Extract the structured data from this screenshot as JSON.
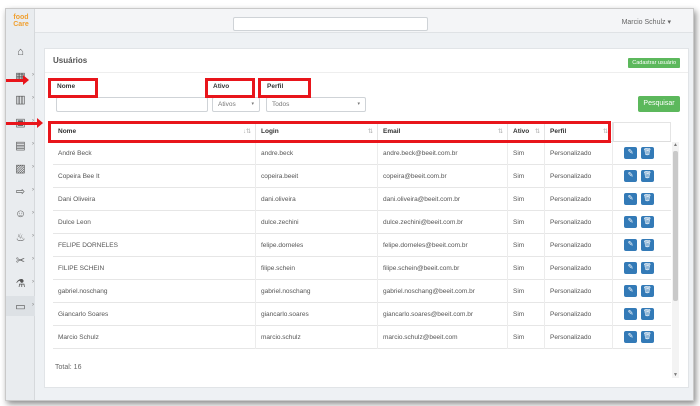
{
  "app": {
    "logo": "food Care"
  },
  "header": {
    "user_name": "Marcio Schulz"
  },
  "page": {
    "title": "Usuários",
    "add_button": "Cadastrar usuário",
    "search_button": "Pesquisar",
    "total": "Total: 16"
  },
  "filters": {
    "name_label": "Nome",
    "name_value": "",
    "active_label": "Ativo",
    "active_value": "Ativos",
    "profile_label": "Perfil",
    "profile_value": "Todos"
  },
  "table": {
    "columns": [
      "Nome",
      "Login",
      "Email",
      "Ativo",
      "Perfil"
    ],
    "rows": [
      [
        "André Beck",
        "andre.beck",
        "andre.beck@beeit.com.br",
        "Sim",
        "Personalizado"
      ],
      [
        "Copeira Bee It",
        "copeira.beeit",
        "copeira@beeit.com.br",
        "Sim",
        "Personalizado"
      ],
      [
        "Dani Oliveira",
        "dani.oliveira",
        "dani.oliveira@beeit.com.br",
        "Sim",
        "Personalizado"
      ],
      [
        "Dulce Leon",
        "dulce.zechini",
        "dulce.zechini@beeit.com.br",
        "Sim",
        "Personalizado"
      ],
      [
        "FELIPE DORNELES",
        "felipe.dorneles",
        "felipe.dorneles@beeit.com.br",
        "Sim",
        "Personalizado"
      ],
      [
        "FILIPE SCHEIN",
        "filipe.schein",
        "filipe.schein@beeit.com.br",
        "Sim",
        "Personalizado"
      ],
      [
        "gabriel.noschang",
        "gabriel.noschang",
        "gabriel.noschang@beeit.com.br",
        "Sim",
        "Personalizado"
      ],
      [
        "Giancarlo Soares",
        "giancarlo.soares",
        "giancarlo.soares@beeit.com.br",
        "Sim",
        "Personalizado"
      ],
      [
        "Marcio Schulz",
        "marcio.schulz",
        "marcio.schulz@beeit.com",
        "Sim",
        "Personalizado"
      ]
    ]
  },
  "sidebar": {
    "items": [
      {
        "icon": "home-icon"
      },
      {
        "icon": "grid-icon"
      },
      {
        "icon": "building-icon"
      },
      {
        "icon": "monitor-icon"
      },
      {
        "icon": "clipboard-icon"
      },
      {
        "icon": "chart-icon"
      },
      {
        "icon": "export-icon"
      },
      {
        "icon": "people-icon"
      },
      {
        "icon": "pot-icon"
      },
      {
        "icon": "tools-icon"
      },
      {
        "icon": "flask-icon"
      },
      {
        "icon": "id-card-icon"
      }
    ]
  },
  "colors": {
    "accent_green": "#5cb85c",
    "action_blue": "#337ab7",
    "annotation_red": "#e8151b"
  }
}
